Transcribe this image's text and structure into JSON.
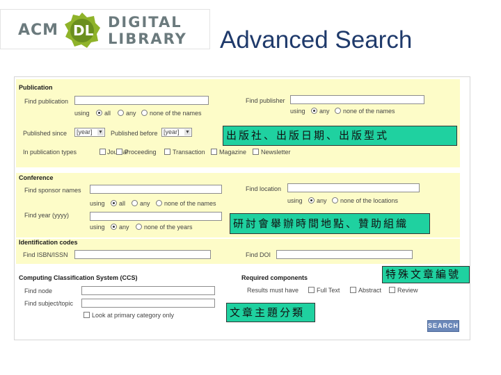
{
  "header": {
    "logo_acm": "ACM",
    "logo_dl": "DL",
    "logo_word1": "DIGITAL",
    "logo_word2": "LIBRARY",
    "page_title": "Advanced Search"
  },
  "publication": {
    "title": "Publication",
    "find_publication_label": "Find publication",
    "find_publisher_label": "Find publisher",
    "using_label": "using",
    "pub_options": [
      "all",
      "any",
      "none of the names"
    ],
    "publisher_options": [
      "any",
      "none of the names"
    ],
    "published_since_label": "Published since",
    "published_before_label": "Published before",
    "year_placeholder": "[year]",
    "types_label": "In publication types",
    "types": [
      "Journal",
      "Proceeding",
      "Transaction",
      "Magazine",
      "Newsletter"
    ]
  },
  "conference": {
    "title": "Conference",
    "find_sponsor_label": "Find sponsor names",
    "find_location_label": "Find location",
    "using_label": "using",
    "sponsor_options": [
      "all",
      "any",
      "none of the names"
    ],
    "location_options": [
      "any",
      "none of the locations"
    ],
    "find_year_label": "Find year (yyyy)",
    "year_options": [
      "any",
      "none of the years"
    ]
  },
  "identification": {
    "title": "Identification codes",
    "isbn_label": "Find ISBN/ISSN",
    "doi_label": "Find DOI"
  },
  "ccs": {
    "title": "Computing Classification System (CCS)",
    "find_node_label": "Find node",
    "find_subject_label": "Find subject/topic",
    "primary_label": "Look at primary category only"
  },
  "required": {
    "title": "Required components",
    "results_label": "Results must have",
    "options": [
      "Full Text",
      "Abstract",
      "Review"
    ]
  },
  "search_button": "SEARCH",
  "annotations": {
    "publication_note": "出版社、出版日期、出版型式",
    "conference_note": "研討會舉辦時間地點、贊助組織",
    "id_note": "特殊文章編號",
    "ccs_note": "文章主題分類"
  },
  "colors": {
    "band": "#fdfcc8",
    "annotation": "#1fd1a0",
    "title": "#1f3a6b",
    "button": "#6b88b9"
  }
}
